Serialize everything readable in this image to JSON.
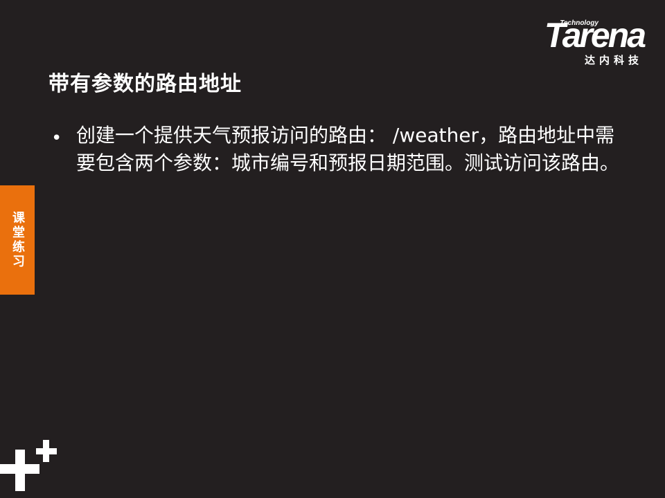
{
  "logo": {
    "technology": "Technology",
    "wordmark": "Tarena",
    "chinese": "达内科技"
  },
  "slide": {
    "title": "带有参数的路由地址",
    "bullets": [
      {
        "text": "创建一个提供天气预报访问的路由： /weather，路由地址中需要包含两个参数：城市编号和预报日期范围。测试访问该路由。"
      }
    ],
    "side_tag": "课堂练习"
  },
  "colors": {
    "background": "#231f20",
    "accent": "#ea700d",
    "text": "#ffffff"
  },
  "icons": {
    "bullet": "bullet-dot-icon",
    "decoration": "plus-icon"
  }
}
